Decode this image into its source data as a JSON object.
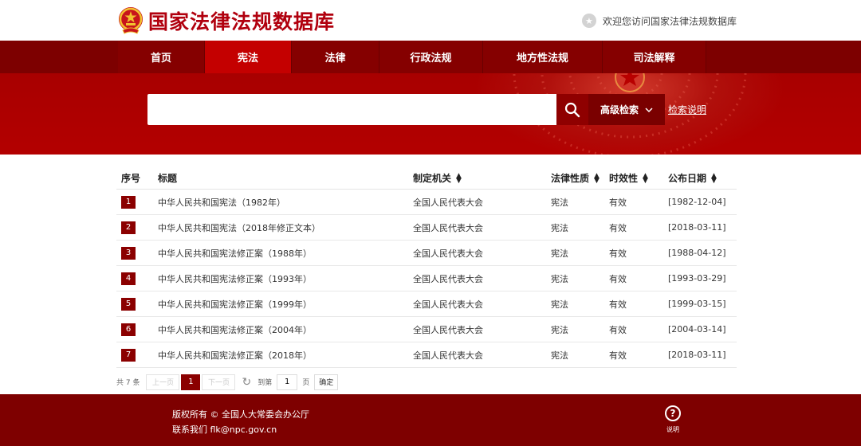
{
  "header": {
    "site_title": "国家法律法规数据库",
    "welcome": "欢迎您访问国家法律法规数据库"
  },
  "nav": {
    "items": [
      {
        "label": "首页"
      },
      {
        "label": "宪法"
      },
      {
        "label": "法律"
      },
      {
        "label": "行政法规"
      },
      {
        "label": "地方性法规"
      },
      {
        "label": "司法解释"
      }
    ],
    "active_index": 1
  },
  "search": {
    "value": "",
    "placeholder": "",
    "advanced_label": "高级检索",
    "help_link": "检索说明"
  },
  "table": {
    "headers": {
      "no": "序号",
      "title": "标题",
      "org": "制定机关",
      "nature": "法律性质",
      "validity": "时效性",
      "date": "公布日期"
    },
    "rows": [
      {
        "no": "1",
        "title": "中华人民共和国宪法（1982年）",
        "org": "全国人民代表大会",
        "nature": "宪法",
        "validity": "有效",
        "date": "[1982-12-04]"
      },
      {
        "no": "2",
        "title": "中华人民共和国宪法（2018年修正文本）",
        "org": "全国人民代表大会",
        "nature": "宪法",
        "validity": "有效",
        "date": "[2018-03-11]"
      },
      {
        "no": "3",
        "title": "中华人民共和国宪法修正案（1988年）",
        "org": "全国人民代表大会",
        "nature": "宪法",
        "validity": "有效",
        "date": "[1988-04-12]"
      },
      {
        "no": "4",
        "title": "中华人民共和国宪法修正案（1993年）",
        "org": "全国人民代表大会",
        "nature": "宪法",
        "validity": "有效",
        "date": "[1993-03-29]"
      },
      {
        "no": "5",
        "title": "中华人民共和国宪法修正案（1999年）",
        "org": "全国人民代表大会",
        "nature": "宪法",
        "validity": "有效",
        "date": "[1999-03-15]"
      },
      {
        "no": "6",
        "title": "中华人民共和国宪法修正案（2004年）",
        "org": "全国人民代表大会",
        "nature": "宪法",
        "validity": "有效",
        "date": "[2004-03-14]"
      },
      {
        "no": "7",
        "title": "中华人民共和国宪法修正案（2018年）",
        "org": "全国人民代表大会",
        "nature": "宪法",
        "validity": "有效",
        "date": "[2018-03-11]"
      }
    ]
  },
  "pager": {
    "total": "共 7 条",
    "prev": "上一页",
    "current": "1",
    "next": "下一页",
    "goto_prefix": "到第",
    "goto_value": "1",
    "goto_suffix": "页",
    "confirm": "确定"
  },
  "footer": {
    "copyright": "版权所有 © 全国人大常委会办公厅",
    "contact": "联系我们 flk@npc.gov.cn",
    "help_label": "说明"
  },
  "colors": {
    "brand_red": "#b1000e",
    "nav_dark": "#7d0000",
    "nav_active": "#c40000",
    "footer": "#7e0000"
  }
}
